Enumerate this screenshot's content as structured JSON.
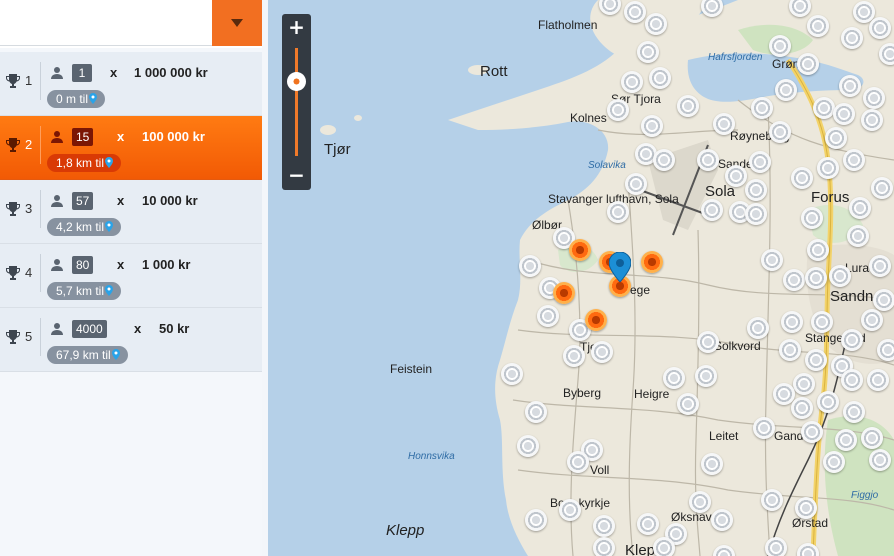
{
  "search": {
    "placeholder": "",
    "value": ""
  },
  "prizes": [
    {
      "rank": "1",
      "winners": "1",
      "multiplier": "x",
      "amount": "1 000 000 kr",
      "distance": "0 m til"
    },
    {
      "rank": "2",
      "winners": "15",
      "multiplier": "x",
      "amount": "100 000 kr",
      "distance": "1,8 km til"
    },
    {
      "rank": "3",
      "winners": "57",
      "multiplier": "x",
      "amount": "10 000 kr",
      "distance": "4,2 km til"
    },
    {
      "rank": "4",
      "winners": "80",
      "multiplier": "x",
      "amount": "1 000 kr",
      "distance": "5,7 km til"
    },
    {
      "rank": "5",
      "winners": "4000",
      "multiplier": "x",
      "amount": "50 kr",
      "distance": "67,9 km til"
    }
  ],
  "active_index": 1,
  "zoom": {
    "in_label": "+",
    "out_label": "−"
  },
  "map": {
    "labels": {
      "flatholmen": "Flatholmen",
      "rott": "Rott",
      "tjor": "Tjør",
      "hafrsfjorden": "Hafrsfjorden",
      "greens": "Grønes",
      "sor_tjora": "Sør Tjora",
      "kolnes": "Kolnes",
      "royneberg": "Røyneberg",
      "sande": "Sande",
      "solavika": "Solavika",
      "stavanger_lufthavn": "Stavanger lufthavn, Sola",
      "sola": "Sola",
      "forus": "Forus",
      "olbor": "Ølbør",
      "lura": "Lura",
      "sandnes": "Sandnes",
      "tjelta": "Tjelta",
      "rege": "ege",
      "stangeland": "Stangeland",
      "solkvord": "Solkvord",
      "feistein": "Feistein",
      "byberg": "Byberg",
      "heigre": "Heigre",
      "leitet": "Leitet",
      "ganddal": "Ganddal",
      "honnsvika": "Honnsvika",
      "voll": "Voll",
      "figgjo": "Figgjo",
      "bore_kyrkje": "Bore kyrkje",
      "oksnavad": "Øksnavad",
      "orstad": "Ørstad",
      "klepp": "Klepp",
      "kleppe": "Kleppe"
    }
  },
  "colors": {
    "accent": "#f26f21",
    "active_row": "#f25a05",
    "pin": "#1c8fd6",
    "badge": "#5a6470"
  }
}
